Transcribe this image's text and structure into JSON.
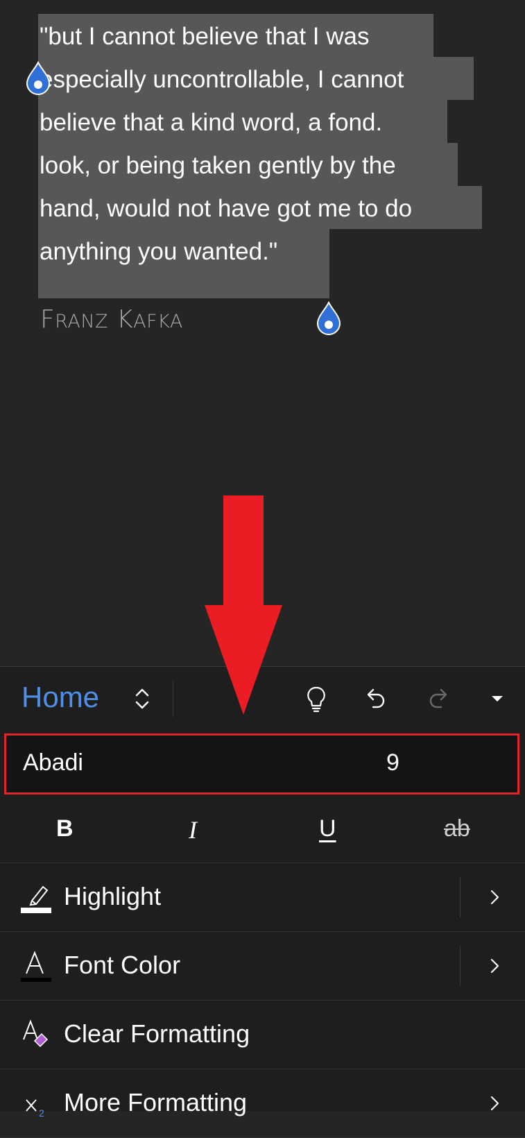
{
  "document": {
    "quote_lines": [
      "\"but I cannot believe that I was",
      "especially uncontrollable, I cannot",
      "believe that a kind word, a fond.",
      "look, or being taken gently by the",
      "hand, would not have got me to do",
      "anything you wanted.\""
    ],
    "author": {
      "first_initial": "F",
      "first_rest": "RANZ",
      "last_initial": "K",
      "last_rest": "AFKA"
    }
  },
  "ribbon": {
    "tab_label": "Home",
    "icons": [
      "expand-collapse-icon",
      "lightbulb-icon",
      "undo-icon",
      "redo-icon",
      "dropdown-caret-icon"
    ]
  },
  "font": {
    "name": "Abadi",
    "size": "9"
  },
  "format_buttons": {
    "bold": "B",
    "italic": "I",
    "underline": "U",
    "strikethrough": "ab"
  },
  "menu": [
    {
      "label": "Highlight",
      "icon": "highlighter-icon",
      "has_chevron": true,
      "has_divider": true
    },
    {
      "label": "Font Color",
      "icon": "font-color-icon",
      "has_chevron": true,
      "has_divider": true
    },
    {
      "label": "Clear Formatting",
      "icon": "clear-formatting-icon",
      "has_chevron": false,
      "has_divider": false
    },
    {
      "label": "More Formatting",
      "icon": "subscript-icon",
      "has_chevron": true,
      "has_divider": false
    }
  ],
  "colors": {
    "accent": "#4f8fe6",
    "selection_handle": "#2f6fd6",
    "annotation_red": "#e0262b",
    "selection_highlight": "#575757"
  }
}
